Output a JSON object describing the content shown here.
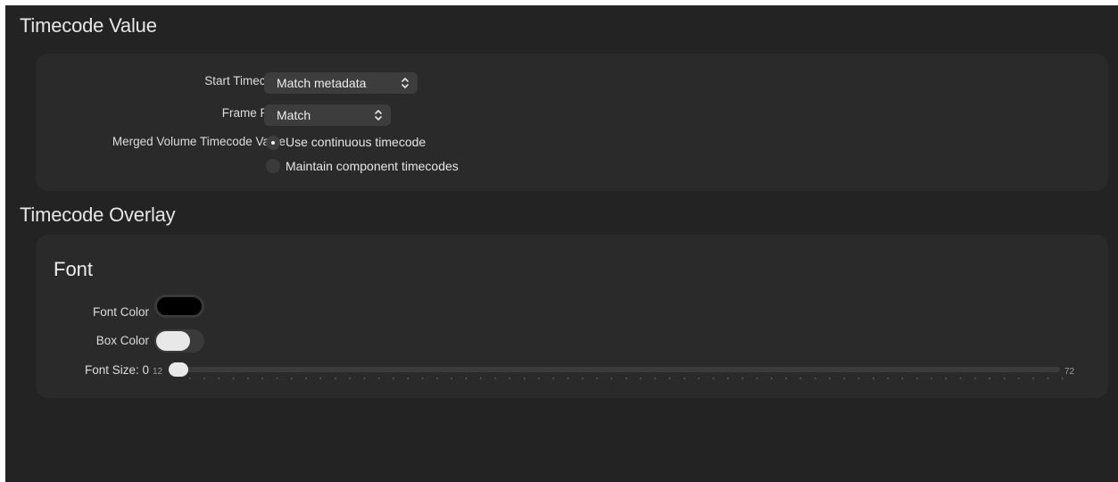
{
  "timecode_value": {
    "title": "Timecode Value",
    "start_timecode": {
      "label": "Start Timecode",
      "value": "Match metadata"
    },
    "frame_rate": {
      "label": "Frame Rate",
      "value": "Match"
    },
    "merged_volume": {
      "label": "Merged Volume Timecode Value",
      "options": [
        {
          "label": "Use continuous timecode",
          "selected": true
        },
        {
          "label": "Maintain component timecodes",
          "selected": false
        }
      ]
    }
  },
  "timecode_overlay": {
    "title": "Timecode Overlay",
    "font": {
      "heading": "Font",
      "font_color": {
        "label": "Font Color",
        "color": "#000000"
      },
      "box_color": {
        "label": "Box Color",
        "color": "#e8e8e8"
      },
      "font_size": {
        "label": "Font Size: 0",
        "min_label": "12",
        "max_label": "72",
        "level": 0
      }
    }
  }
}
